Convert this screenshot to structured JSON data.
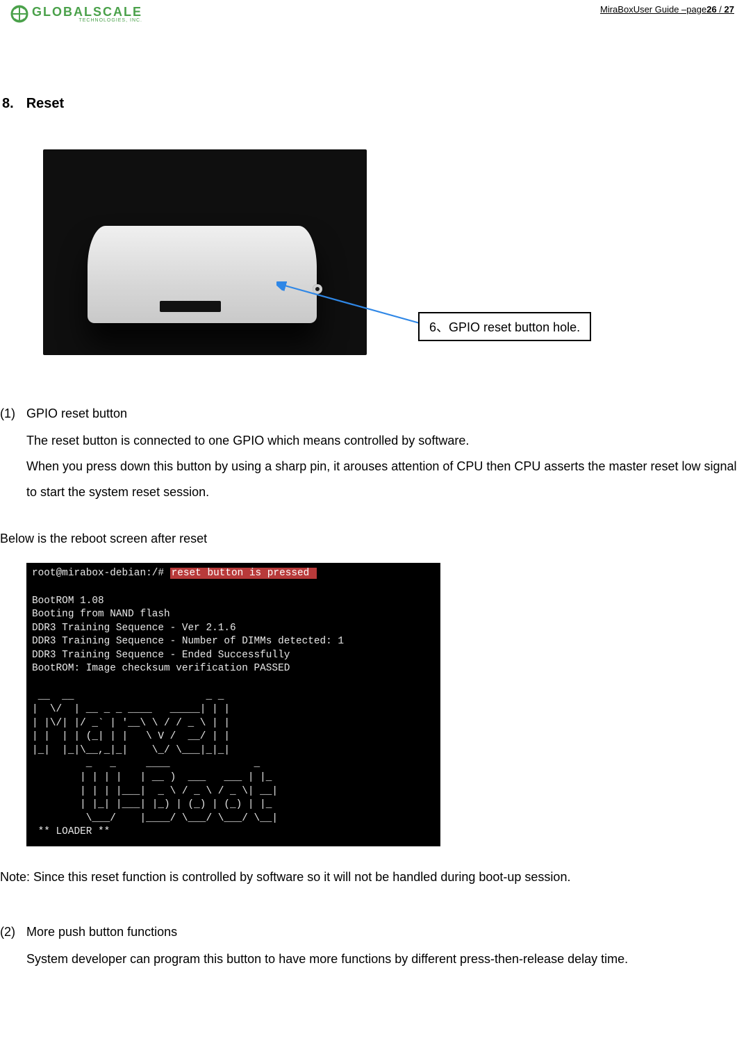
{
  "header": {
    "logo_main": "GLOBALSCALE",
    "logo_sub": "TECHNOLOGIES, INC.",
    "page_label_prefix": "MiraBoxUser Guide –page",
    "page_current": "26",
    "page_sep": " / ",
    "page_total": "27"
  },
  "section": {
    "number": "8.",
    "title": "Reset"
  },
  "callout": {
    "label": "6、GPIO reset button hole."
  },
  "item1": {
    "marker": "(1)",
    "title": "GPIO reset button",
    "p1": "The reset button is connected to one GPIO which means controlled by software.",
    "p2": "When you press down this button by using a sharp pin, it arouses attention of CPU then CPU asserts the master reset low signal to start the system reset session."
  },
  "below_label": "Below is the reboot screen after reset",
  "terminal": {
    "prompt": "root@mirabox-debian:/# ",
    "highlight": "reset button is pressed ",
    "lines1": "\nBootROM 1.08\nBooting from NAND flash\nDDR3 Training Sequence - Ver 2.1.6\nDDR3 Training Sequence - Number of DIMMs detected: 1\nDDR3 Training Sequence - Ended Successfully\nBootROM: Image checksum verification PASSED\n",
    "ascii": " __  __                      _ _\n|  \\/  | __ _ _ ____   _____| | |\n| |\\/| |/ _` | '__\\ \\ / / _ \\ | |\n| |  | | (_| | |   \\ V /  __/ | |\n|_|  |_|\\__,_|_|    \\_/ \\___|_|_|\n         _   _     ____              _\n        | | | |   | __ )  ___   ___ | |_\n        | | | |___|  _ \\ / _ \\ / _ \\| __|\n        | |_| |___| |_) | (_) | (_) | |_\n         \\___/    |____/ \\___/ \\___/ \\__|\n ** LOADER **"
  },
  "note": "Note: Since this reset function is controlled by software so it will not be handled during boot-up session.",
  "item2": {
    "marker": "(2)",
    "title": "More push button functions",
    "p1": "System developer can program this button to have more functions by different press-then-release delay time."
  }
}
